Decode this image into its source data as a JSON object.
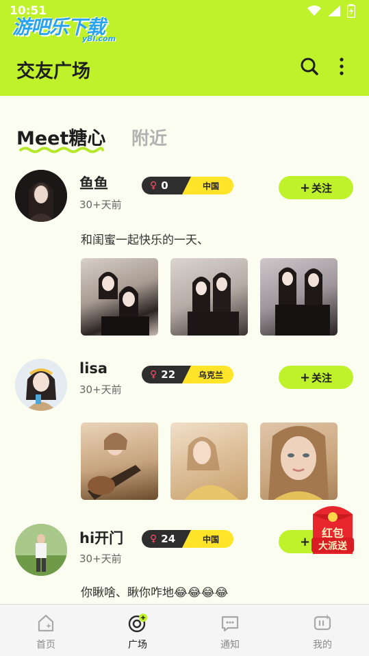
{
  "status_bar": {
    "time": "10:51"
  },
  "watermark": {
    "main": "游吧乐下载",
    "sub": "yBl.com"
  },
  "header": {
    "title": "交友广场"
  },
  "tabs": [
    {
      "label": "Meet糖心",
      "active": true
    },
    {
      "label": "附近",
      "active": false
    }
  ],
  "posts": [
    {
      "username": "鱼鱼",
      "time": "30+天前",
      "gender_symbol": "♀",
      "age": "0",
      "location": "中国",
      "follow_label": "关注",
      "text": "和闺蜜一起快乐的一天、",
      "photo_count": 3
    },
    {
      "username": "lisa",
      "time": "30+天前",
      "gender_symbol": "♀",
      "age": "22",
      "location": "乌克兰",
      "follow_label": "关注",
      "text": "",
      "photo_count": 3
    },
    {
      "username": "hi开门",
      "time": "30+天前",
      "gender_symbol": "♀",
      "age": "24",
      "location": "中国",
      "follow_label": "关注",
      "text": "你瞅啥、瞅你咋地😂😂😂😂",
      "photo_count": 0
    }
  ],
  "red_packet": {
    "line1": "红包",
    "line2": "大派送"
  },
  "bottom_nav": [
    {
      "label": "首页",
      "icon": "home-icon",
      "active": false
    },
    {
      "label": "广场",
      "icon": "plaza-icon",
      "active": true
    },
    {
      "label": "通知",
      "icon": "message-icon",
      "active": false
    },
    {
      "label": "我的",
      "icon": "profile-icon",
      "active": false
    }
  ],
  "colors": {
    "accent": "#bff22b",
    "badge_dark": "#2e2e2e",
    "badge_yellow": "#ffe42a",
    "background": "#fafdf0"
  }
}
